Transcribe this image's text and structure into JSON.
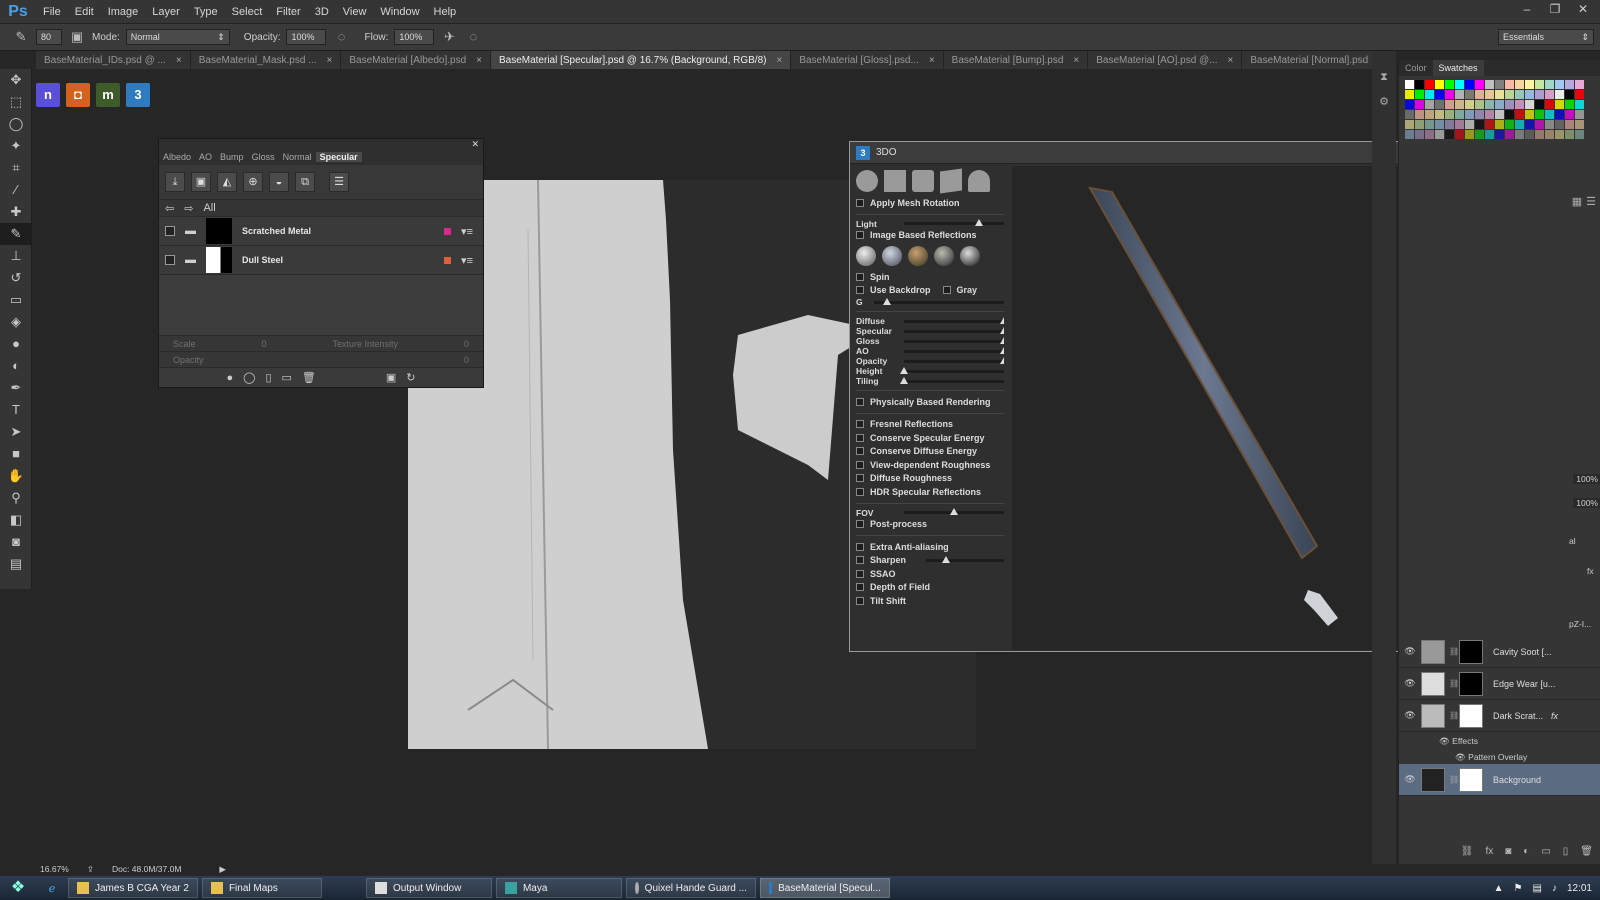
{
  "app": {
    "logo": "Ps"
  },
  "menu": [
    "File",
    "Edit",
    "Image",
    "Layer",
    "Type",
    "Select",
    "Filter",
    "3D",
    "View",
    "Window",
    "Help"
  ],
  "window_controls": {
    "minimize": "–",
    "restore": "❐",
    "close": "✕"
  },
  "options": {
    "brush_size": "80",
    "mode_label": "Mode:",
    "mode_value": "Normal",
    "opacity_label": "Opacity:",
    "opacity_value": "100%",
    "flow_label": "Flow:",
    "flow_value": "100%",
    "workspace": "Essentials"
  },
  "doc_tabs": [
    {
      "label": "BaseMaterial_IDs.psd @ ...",
      "close": "×"
    },
    {
      "label": "BaseMaterial_Mask.psd ...",
      "close": "×"
    },
    {
      "label": "BaseMaterial [Albedo].psd",
      "close": "×"
    },
    {
      "label": "BaseMaterial [Specular].psd @ 16.7% (Background, RGB/8)",
      "close": "×"
    },
    {
      "label": "BaseMaterial [Gloss].psd...",
      "close": "×"
    },
    {
      "label": "BaseMaterial [Bump].psd",
      "close": "×"
    },
    {
      "label": "BaseMaterial [AO].psd @...",
      "close": "×"
    },
    {
      "label": "BaseMaterial [Normal].psd",
      "close": "×"
    }
  ],
  "plugins": [
    {
      "glyph": "n",
      "color": "#5a4fd8"
    },
    {
      "glyph": "◘",
      "color": "#d4611d"
    },
    {
      "glyph": "m",
      "color": "#3d5c2a"
    },
    {
      "glyph": "3",
      "color": "#2e7bbf"
    }
  ],
  "suite_panel": {
    "tabs": [
      "Albedo",
      "AO",
      "Bump",
      "Gloss",
      "Normal",
      "Specular"
    ],
    "active_tab": "Specular",
    "nav_label": "All",
    "materials": [
      {
        "name": "Scratched Metal",
        "swatch": "#d72a8a"
      },
      {
        "name": "Dull Steel",
        "swatch": "#e0603a"
      }
    ],
    "scale_label": "Scale",
    "scale_value": "0",
    "texture_intensity_label": "Texture Intensity",
    "texture_intensity_value": "0",
    "opacity_label": "Opacity",
    "opacity_value": "0"
  },
  "ddo": {
    "title": "3DO",
    "logo": "3",
    "apply_mesh_rotation": "Apply Mesh Rotation",
    "light": {
      "label": "Light",
      "value": 0.75
    },
    "image_based_reflections": "Image Based Reflections",
    "spin": "Spin",
    "use_backdrop": "Use Backdrop",
    "gray": "Gray",
    "g_label": "G",
    "g_value": 0.1,
    "channels": [
      {
        "label": "Diffuse",
        "value": 1.0
      },
      {
        "label": "Specular",
        "value": 1.0
      },
      {
        "label": "Gloss",
        "value": 1.0
      },
      {
        "label": "AO",
        "value": 1.0
      },
      {
        "label": "Opacity",
        "value": 1.0
      },
      {
        "label": "Height",
        "value": 0.0
      },
      {
        "label": "Tiling",
        "value": 0.0
      }
    ],
    "pbr": "Physically Based Rendering",
    "pbr_options": [
      "Fresnel Reflections",
      "Conserve Specular Energy",
      "Conserve Diffuse Energy",
      "View-dependent Roughness",
      "Diffuse Roughness",
      "HDR Specular Reflections"
    ],
    "fov_label": "FOV",
    "fov_value": 0.5,
    "post_process": "Post-process",
    "post_options": [
      "Extra Anti-aliasing",
      "Sharpen",
      "SSAO",
      "Depth of Field",
      "Tilt Shift"
    ],
    "sharpen_value": 0.25,
    "wbtns": [
      "–",
      "▢",
      "✕"
    ]
  },
  "right_panel": {
    "tabs": [
      "Color",
      "Swatches"
    ],
    "active_tab": "Swatches",
    "zoom1": "100%",
    "zoom2": "100%",
    "partial_labels": [
      "al",
      "fx",
      "pZ-I..."
    ],
    "layers": [
      {
        "name": "Cavity Soot [...",
        "fx": ""
      },
      {
        "name": "Edge Wear [u...",
        "fx": ""
      },
      {
        "name": "Dark Scrat...",
        "fx": "fx"
      }
    ],
    "effects_label": "Effects",
    "pattern_overlay": "Pattern Overlay",
    "background_layer": "Background"
  },
  "status": {
    "zoom": "16.67%",
    "doc": "Doc: 48.0M/37.0M"
  },
  "taskbar": {
    "items": [
      {
        "label": "James B CGA Year 2",
        "color": "#e8c050"
      },
      {
        "label": "Final Maps",
        "color": "#e8c050"
      },
      {
        "label": "Output Window",
        "color": "#ddd"
      },
      {
        "label": "Maya",
        "color": "#3aa0a0"
      },
      {
        "label": "Quixel Hande Guard ...",
        "color": "#aaa"
      },
      {
        "label": "BaseMaterial [Specul...",
        "color": "#2e7bbf"
      }
    ],
    "time": "12:01"
  }
}
